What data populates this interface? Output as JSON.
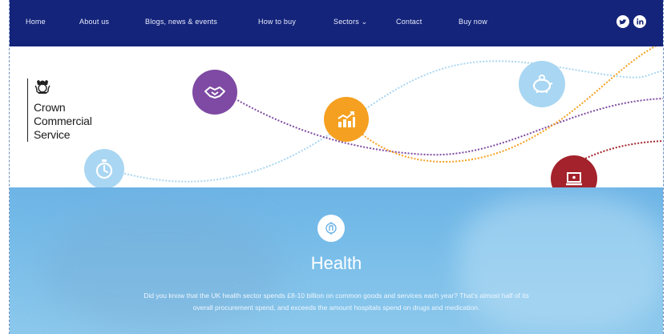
{
  "nav": {
    "items": [
      "Home",
      "About us",
      "Blogs, news & events",
      "How to buy",
      "Sectors ⌄",
      "Contact",
      "Buy now"
    ]
  },
  "social": {
    "icons": [
      "twitter-icon",
      "linkedin-icon"
    ]
  },
  "logo": {
    "lines": [
      "Crown",
      "Commercial",
      "Service"
    ]
  },
  "hero_icons": [
    "handshake-icon",
    "stopwatch-icon",
    "chart-icon",
    "piggy-bank-icon",
    "laptop-icon"
  ],
  "banner": {
    "title": "Health",
    "desc_line1": "Did you know that the UK health sector spends £8-10 billion on common goods and services each year? That's almost half of its",
    "desc_line2": "overall procurement spend, and exceeds the amount hospitals spend on drugs and medication."
  },
  "colors": {
    "nav_bg": "#14247a",
    "purple": "#7e4aa3",
    "orange": "#f5a020",
    "light_blue": "#a9d6f2",
    "dark_red": "#a3222b",
    "banner_blue": "#6db4e6"
  }
}
